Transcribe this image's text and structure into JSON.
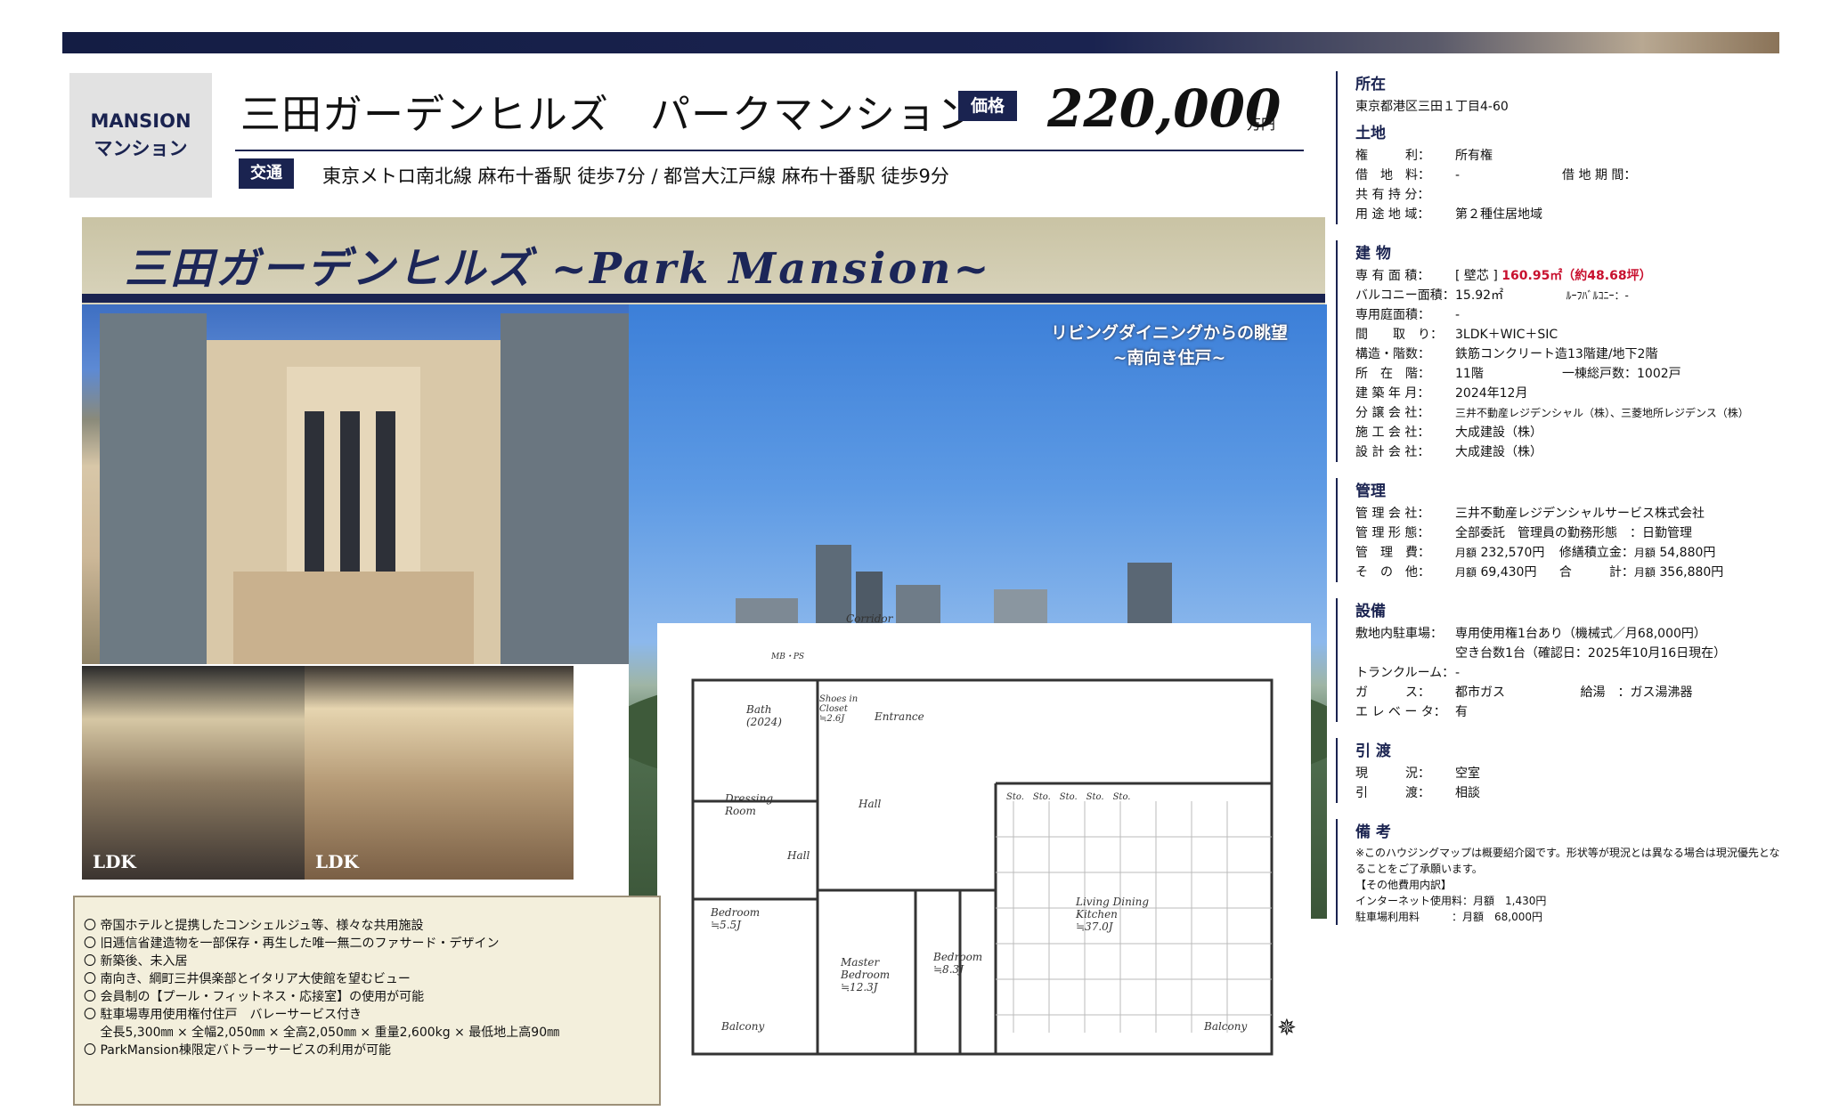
{
  "header": {
    "badge_line1": "MANSION",
    "badge_line2": "マンション",
    "title": "三田ガーデンヒルズ　パークマンション",
    "price_label": "価格",
    "price": "220,000",
    "price_unit": "万円",
    "access_label": "交通",
    "access": "東京メトロ南北線 麻布十番駅 徒歩7分 / 都営大江戸線 麻布十番駅 徒歩9分"
  },
  "banner": {
    "title": "三田ガーデンヒルズ ~Park Mansion~"
  },
  "photos": {
    "ldk1": "LDK",
    "ldk2": "LDK",
    "view_caption_1": "リビングダイニングからの眺望",
    "view_caption_2": "~南向き住戸~"
  },
  "floorplan": {
    "corridor": "Corridor",
    "mb_ps": "MB・PS",
    "bath": "Bath (2024)",
    "shoes": "Shoes in Closet ≒2.6J",
    "entrance": "Entrance",
    "dressing": "Dressing Room",
    "hall1": "Hall",
    "hall2": "Hall",
    "bedroom1": "Bedroom ≒5.5J",
    "master": "Master Bedroom ≒12.3J",
    "bedroom2": "Bedroom ≒8.3J",
    "ldk": "Living Dining Kitchen ≒37.0J",
    "balcony1": "Balcony",
    "balcony2": "Balcony",
    "sto_row": "Sto.　Sto.　Sto.　Sto.　Sto."
  },
  "features": [
    "〇 帝国ホテルと提携したコンシェルジュ等、様々な共用施設",
    "〇 旧逓信省建造物を一部保存・再生した唯一無二のファサード・デザイン",
    "〇 新築後、未入居",
    "〇 南向き、綱町三井倶楽部とイタリア大使館を望むビュー",
    "〇 会員制の【プール・フィットネス・応接室】の使用が可能",
    "〇 駐車場専用使用権付住戸　バレーサービス付き",
    "　 全長5,300㎜ × 全幅2,050㎜ × 全高2,050㎜ × 重量2,600kg × 最低地上高90㎜",
    "〇 ParkMansion棟限定バトラーサービスの利用が可能"
  ],
  "info": {
    "location": {
      "title": "所在",
      "value": "東京都港区三田１丁目4-60"
    },
    "land": {
      "title": "土地",
      "rows": [
        {
          "k": "権　　　利：",
          "v": "所有権",
          "k2": "",
          "v2": ""
        },
        {
          "k": "借　地　料：",
          "v": "-",
          "k2": "借 地 期 間：",
          "v2": ""
        },
        {
          "k": "共 有 持 分：",
          "v": "",
          "k2": "",
          "v2": ""
        },
        {
          "k": "用 途 地 域：",
          "v": "第２種住居地域",
          "k2": "",
          "v2": ""
        }
      ]
    },
    "building": {
      "title": "建 物",
      "area_key": "専 有 面 積：",
      "area_prefix": "[ 壁芯 ]",
      "area_value": "160.95㎡（約48.68坪）",
      "balcony_key": "バルコニー面積：",
      "balcony_value": "15.92㎡",
      "roof_key": "ﾙｰﾌﾊﾞﾙｺﾆｰ：",
      "roof_value": "-",
      "rows": [
        {
          "k": "専用庭面積：",
          "v": "-"
        },
        {
          "k": "間　　取　り：",
          "v": "3LDK＋WIC＋SIC"
        },
        {
          "k": "構造・階数：",
          "v": "鉄筋コンクリート造13階建/地下2階"
        },
        {
          "k": "所　在　階：",
          "v": "11階",
          "k2": "一棟総戸数：",
          "v2": "1002戸"
        },
        {
          "k": "建 築 年 月：",
          "v": "2024年12月"
        },
        {
          "k": "分 譲 会 社：",
          "v": "三井不動産レジデンシャル（株）、三菱地所レジデンス（株）"
        },
        {
          "k": "施 工 会 社：",
          "v": "大成建設（株）"
        },
        {
          "k": "設 計 会 社：",
          "v": "大成建設（株）"
        }
      ]
    },
    "management": {
      "title": "管理",
      "company_key": "管 理 会 社：",
      "company": "三井不動産レジデンシャルサービス株式会社",
      "form_key": "管 理 形 態：",
      "form": "全部委託　管理員の勤務形態　：日勤管理",
      "fee_key": "管　理　費：",
      "fee_prefix": "月額",
      "fee": "232,570円",
      "reserve_key": "修繕積立金：",
      "reserve_prefix": "月額",
      "reserve": "54,880円",
      "other_key": "そ　の　他：",
      "other_prefix": "月額",
      "other": "69,430円",
      "total_key": "合　　　計：",
      "total_prefix": "月額",
      "total": "356,880円"
    },
    "facility": {
      "title": "設備",
      "parking_key": "敷地内駐車場：",
      "parking1": "専用使用権1台あり（機械式／月68,000円）",
      "parking2": "空き台数1台（確認日：2025年10月16日現在）",
      "trunk_key": "トランクルーム：",
      "trunk": "-",
      "gas_key": "ガ　　　ス：",
      "gas": "都市ガス",
      "hot_key": "給湯　：",
      "hot": "ガス湯沸器",
      "elev_key": "エ レ ベ ー タ：",
      "elev": "有"
    },
    "handover": {
      "title": "引 渡",
      "status_key": "現　　　況：",
      "status": "空室",
      "handover_key": "引　　　渡：",
      "handover": "相談"
    },
    "remarks": {
      "title": "備 考",
      "line1": "※このハウジングマップは概要紹介図です。形状等が現況とは異なる場合は現況優先となることをご了承願います。",
      "line2": "【その他費用内訳】",
      "line3": "インターネット使用料：月額　1,430円",
      "line4": "駐車場利用料　　　：月額　68,000円"
    }
  }
}
